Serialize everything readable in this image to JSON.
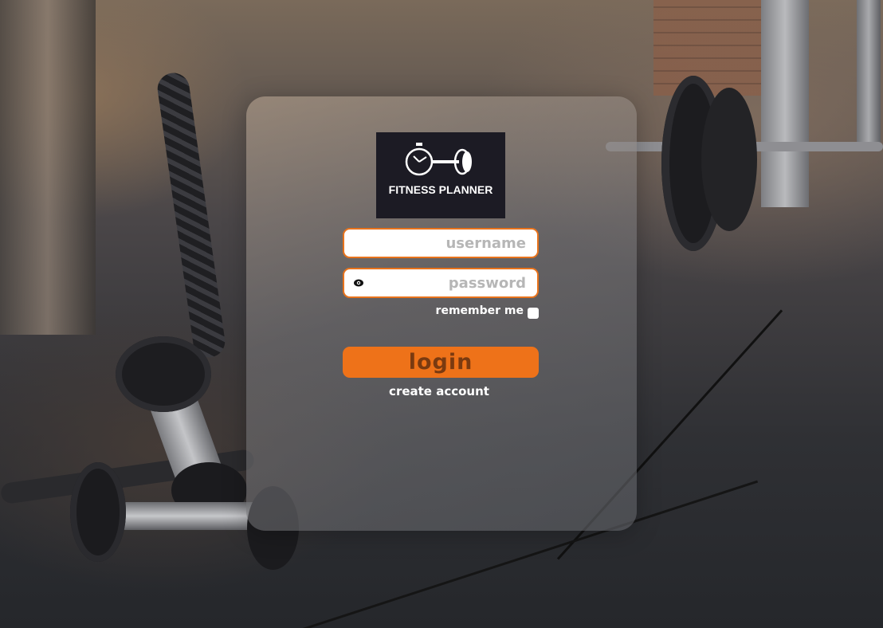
{
  "logo": {
    "text": "FITNESS PLANNER",
    "icon": "stopwatch-barbell-icon",
    "background": "#1c1b24"
  },
  "login_form": {
    "username_placeholder": "username",
    "password_placeholder": "password",
    "password_toggle_icon": "eye-icon",
    "remember_label": "remember me",
    "remember_checked": false,
    "login_label": "login",
    "create_account_label": "create account"
  },
  "colors": {
    "accent": "#ee7219",
    "field_border": "#e8731c",
    "login_text": "#7a3a10"
  }
}
